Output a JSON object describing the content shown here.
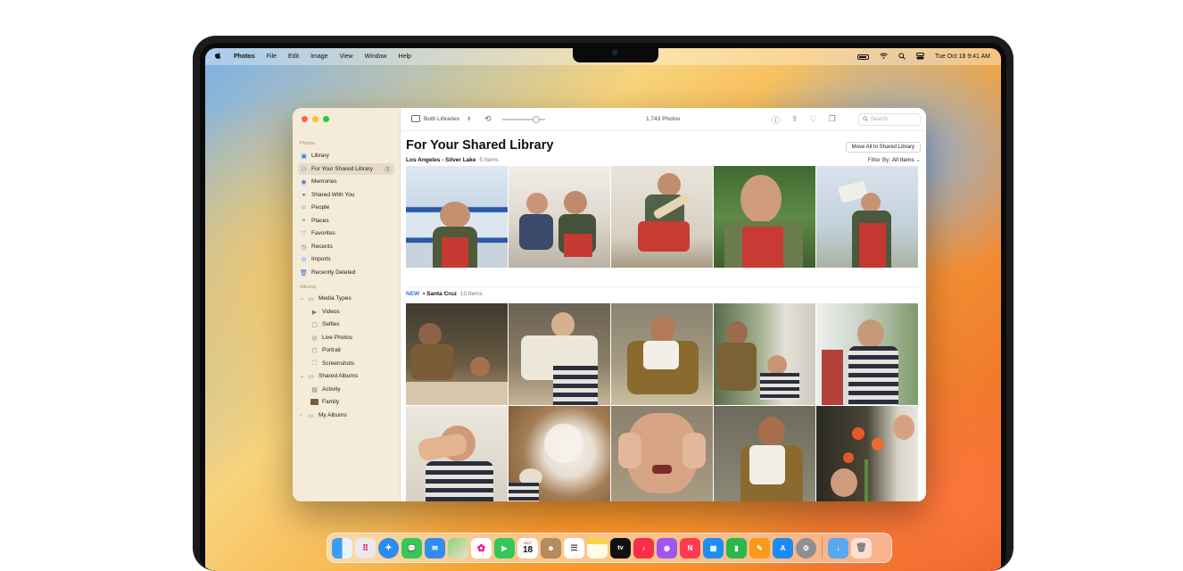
{
  "menubar": {
    "apple_icon": "apple-logo",
    "items": [
      "Photos",
      "File",
      "Edit",
      "Image",
      "View",
      "Window",
      "Help"
    ],
    "datetime": "Tue Oct 18  9:41 AM",
    "status_icons": [
      "battery-icon",
      "wifi-icon",
      "search-icon",
      "control-center-icon"
    ]
  },
  "sidebar": {
    "photos_section": "Photos",
    "photos_items": [
      {
        "label": "Library",
        "icon": "photo-library-icon"
      },
      {
        "label": "For Your Shared Library",
        "icon": "people-icon",
        "badge": "1"
      },
      {
        "label": "Memories",
        "icon": "memories-icon"
      },
      {
        "label": "Shared With You",
        "icon": "shared-with-you-icon"
      },
      {
        "label": "People",
        "icon": "person-icon"
      },
      {
        "label": "Places",
        "icon": "map-pin-icon"
      },
      {
        "label": "Favorites",
        "icon": "heart-icon"
      },
      {
        "label": "Recents",
        "icon": "clock-icon"
      },
      {
        "label": "Imports",
        "icon": "import-icon"
      },
      {
        "label": "Recently Deleted",
        "icon": "trash-icon"
      }
    ],
    "albums_section": "Albums",
    "album_items": [
      {
        "label": "Media Types",
        "icon": "folder-icon"
      },
      {
        "label": "Videos",
        "icon": "video-icon"
      },
      {
        "label": "Selfies",
        "icon": "selfie-icon"
      },
      {
        "label": "Live Photos",
        "icon": "live-photo-icon"
      },
      {
        "label": "Portrait",
        "icon": "portrait-icon"
      },
      {
        "label": "Screenshots",
        "icon": "screenshot-icon"
      },
      {
        "label": "Shared Albums",
        "icon": "folder-icon"
      },
      {
        "label": "Activity",
        "icon": "activity-icon"
      },
      {
        "label": "Family",
        "icon": "album-thumbnail-icon"
      },
      {
        "label": "My Albums",
        "icon": "folder-icon"
      }
    ]
  },
  "toolbar": {
    "library_selector": "Both Libraries",
    "photo_count": "1,743 Photos",
    "search_placeholder": "Search"
  },
  "main": {
    "title": "For Your Shared Library",
    "move_all_button": "Move All to Shared Library",
    "filter_prefix": "Filter By:",
    "filter_value": "All Items",
    "group1": {
      "label": "Los Angeles - Silver Lake",
      "count": "5 Items"
    },
    "group2": {
      "new_badge": "NEW",
      "separator": "•",
      "label": "Santa Cruz",
      "count": "10 Items"
    }
  },
  "colors": {
    "accent": "#2f7ce0",
    "sidebar_bg": "#f4ebd8",
    "close": "#ff5f57",
    "minimize": "#febc2e",
    "zoom": "#28c840"
  },
  "dock": {
    "apps": [
      "Finder",
      "Launchpad",
      "Safari",
      "Messages",
      "Mail",
      "Maps",
      "Photos",
      "FaceTime",
      "Calendar",
      "Contacts",
      "Reminders",
      "Notes",
      "TV",
      "Music",
      "Podcasts",
      "News",
      "Keynote",
      "Numbers",
      "Pages",
      "App Store",
      "System Settings",
      "Downloads",
      "Trash"
    ],
    "calendar_month": "OCT",
    "calendar_day": "18",
    "tv_label": "tv"
  }
}
